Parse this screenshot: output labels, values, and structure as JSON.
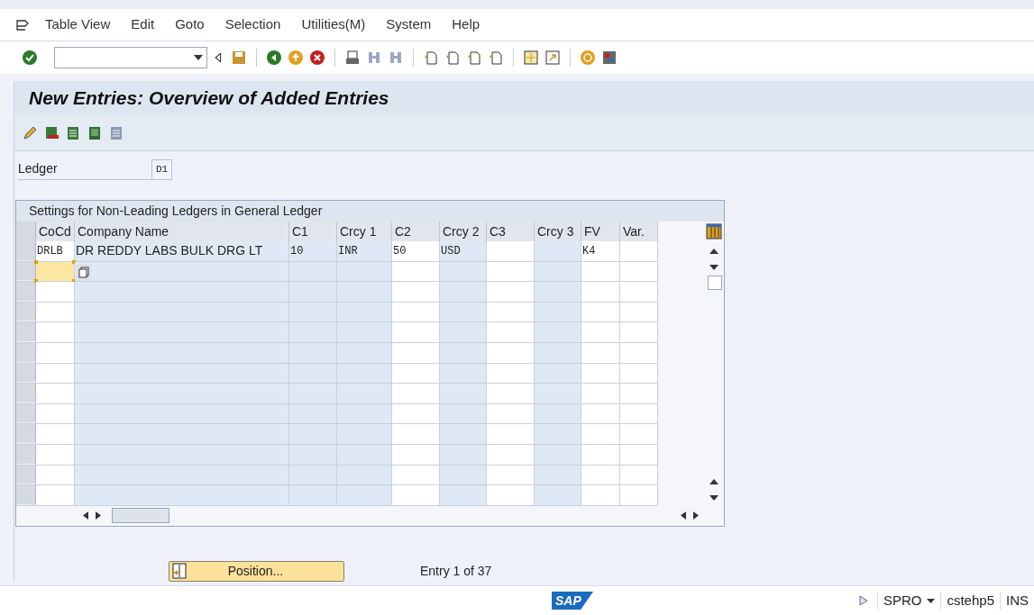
{
  "menu": [
    "Table View",
    "Edit",
    "Goto",
    "Selection",
    "Utilities(M)",
    "System",
    "Help"
  ],
  "screen_title": "New Entries: Overview of Added Entries",
  "ledger": {
    "label": "Ledger",
    "value": "D1"
  },
  "table": {
    "title": "Settings for Non-Leading Ledgers in General Ledger",
    "columns": [
      {
        "label": "CoCd",
        "shaded": false
      },
      {
        "label": "Company Name",
        "shaded": true
      },
      {
        "label": "C1",
        "shaded": true
      },
      {
        "label": "Crcy 1",
        "shaded": true
      },
      {
        "label": "C2",
        "shaded": false
      },
      {
        "label": "Crcy 2",
        "shaded": true
      },
      {
        "label": "C3",
        "shaded": false
      },
      {
        "label": "Crcy 3",
        "shaded": true
      },
      {
        "label": "FV",
        "shaded": false
      },
      {
        "label": "Var.",
        "shaded": false
      }
    ],
    "rows": [
      {
        "cells": [
          "DRLB",
          "DR REDDY LABS BULK DRG LT",
          "10",
          "INR",
          "50",
          "USD",
          "",
          "",
          "K4",
          ""
        ],
        "focused": false
      },
      {
        "cells": [
          "",
          "",
          "",
          "",
          "",
          "",
          "",
          "",
          "",
          ""
        ],
        "focused": true
      },
      {
        "cells": [
          "",
          "",
          "",
          "",
          "",
          "",
          "",
          "",
          "",
          ""
        ],
        "focused": false
      },
      {
        "cells": [
          "",
          "",
          "",
          "",
          "",
          "",
          "",
          "",
          "",
          ""
        ],
        "focused": false
      },
      {
        "cells": [
          "",
          "",
          "",
          "",
          "",
          "",
          "",
          "",
          "",
          ""
        ],
        "focused": false
      },
      {
        "cells": [
          "",
          "",
          "",
          "",
          "",
          "",
          "",
          "",
          "",
          ""
        ],
        "focused": false
      },
      {
        "cells": [
          "",
          "",
          "",
          "",
          "",
          "",
          "",
          "",
          "",
          ""
        ],
        "focused": false
      },
      {
        "cells": [
          "",
          "",
          "",
          "",
          "",
          "",
          "",
          "",
          "",
          ""
        ],
        "focused": false
      },
      {
        "cells": [
          "",
          "",
          "",
          "",
          "",
          "",
          "",
          "",
          "",
          ""
        ],
        "focused": false
      },
      {
        "cells": [
          "",
          "",
          "",
          "",
          "",
          "",
          "",
          "",
          "",
          ""
        ],
        "focused": false
      },
      {
        "cells": [
          "",
          "",
          "",
          "",
          "",
          "",
          "",
          "",
          "",
          ""
        ],
        "focused": false
      },
      {
        "cells": [
          "",
          "",
          "",
          "",
          "",
          "",
          "",
          "",
          "",
          ""
        ],
        "focused": false
      },
      {
        "cells": [
          "",
          "",
          "",
          "",
          "",
          "",
          "",
          "",
          "",
          ""
        ],
        "focused": false
      }
    ]
  },
  "position_button": "Position...",
  "entry_info": "Entry 1 of 37",
  "status_bar": {
    "logo": "SAP",
    "transaction": "SPRO",
    "server": "cstehp5",
    "mode": "INS"
  }
}
